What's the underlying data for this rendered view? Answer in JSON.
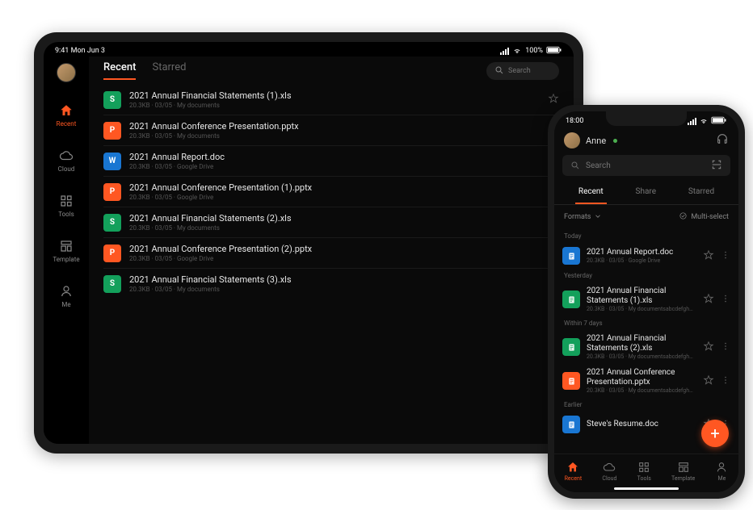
{
  "tablet": {
    "status": {
      "time": "9:41 Mon Jun 3",
      "battery": "100%"
    },
    "nav": [
      {
        "label": "Recent",
        "icon": "home"
      },
      {
        "label": "Cloud",
        "icon": "cloud"
      },
      {
        "label": "Tools",
        "icon": "grid"
      },
      {
        "label": "Template",
        "icon": "template"
      },
      {
        "label": "Me",
        "icon": "person"
      }
    ],
    "tabs": [
      {
        "label": "Recent"
      },
      {
        "label": "Starred"
      }
    ],
    "search_placeholder": "Search",
    "files": [
      {
        "type": "xls",
        "name": "2021 Annual Financial Statements (1).xls",
        "meta": "20.3KB · 03/05 · My documents"
      },
      {
        "type": "pptx",
        "name": "2021 Annual Conference Presentation.pptx",
        "meta": "20.3KB · 03/05 · My documents"
      },
      {
        "type": "doc",
        "name": "2021 Annual Report.doc",
        "meta": "20.3KB · 03/05 · Google Drive"
      },
      {
        "type": "pptx",
        "name": "2021 Annual Conference Presentation (1).pptx",
        "meta": "20.3KB · 03/05 · Google Drive"
      },
      {
        "type": "xls",
        "name": "2021 Annual Financial Statements (2).xls",
        "meta": "20.3KB · 03/05 · My documents"
      },
      {
        "type": "pptx",
        "name": "2021 Annual Conference Presentation (2).pptx",
        "meta": "20.3KB · 03/05 · Google Drive"
      },
      {
        "type": "xls",
        "name": "2021 Annual Financial Statements (3).xls",
        "meta": "20.3KB · 03/05 · My documents"
      }
    ]
  },
  "phone": {
    "status": {
      "time": "18:00"
    },
    "user": "Anne",
    "search_placeholder": "Search",
    "tabs": [
      {
        "label": "Recent"
      },
      {
        "label": "Share"
      },
      {
        "label": "Starred"
      }
    ],
    "toolbar": {
      "left": "Formats",
      "right": "Multi-select"
    },
    "nav": [
      {
        "label": "Recent",
        "icon": "home"
      },
      {
        "label": "Cloud",
        "icon": "cloud"
      },
      {
        "label": "Tools",
        "icon": "grid"
      },
      {
        "label": "Template",
        "icon": "template"
      },
      {
        "label": "Me",
        "icon": "person"
      }
    ],
    "sections": [
      {
        "title": "Today",
        "items": [
          {
            "type": "doc",
            "name": "2021 Annual Report.doc",
            "meta": "20.3KB · 03/05 · Google Drive"
          }
        ]
      },
      {
        "title": "Yesterday",
        "items": [
          {
            "type": "xls",
            "name": "2021 Annual Financial Statements (1).xls",
            "meta": "20.3KB · 03/05 · My documentsabcdefgh…"
          }
        ]
      },
      {
        "title": "Within 7 days",
        "items": [
          {
            "type": "xls",
            "name": "2021 Annual Financial Statements (2).xls",
            "meta": "20.3KB · 03/05 · My documentsabcdefgh…"
          },
          {
            "type": "pptx",
            "name": "2021 Annual Conference Presentation.pptx",
            "meta": "20.3KB · 03/05 · My documentsabcdefgh…"
          }
        ]
      },
      {
        "title": "Earlier",
        "items": [
          {
            "type": "doc",
            "name": "Steve's Resume.doc",
            "meta": ""
          }
        ]
      }
    ]
  },
  "icons": {
    "home": "<svg viewBox='0 0 24 24' width='18' height='18'><path fill='currentColor' d='M12 3l9 8h-3v9h-4v-6h-4v6H6v-9H3z'/></svg>",
    "cloud": "<svg viewBox='0 0 24 24' width='18' height='18'><path fill='none' stroke='currentColor' stroke-width='1.6' d='M7 18a5 5 0 010-10 6 6 0 0111 2 4 4 0 010 8H7z'/></svg>",
    "grid": "<svg viewBox='0 0 24 24' width='18' height='18'><path fill='none' stroke='currentColor' stroke-width='1.6' d='M4 4h6v6H4zM14 4h6v6h-6zM4 14h6v6H4zM14 14h6v6h-6z'/></svg>",
    "template": "<svg viewBox='0 0 24 24' width='18' height='18'><path fill='none' stroke='currentColor' stroke-width='1.6' d='M4 4h16v5H4zM4 12h7v8H4zM14 12h6v8h-6z'/></svg>",
    "person": "<svg viewBox='0 0 24 24' width='18' height='18'><path fill='none' stroke='currentColor' stroke-width='1.6' d='M12 12a4 4 0 100-8 4 4 0 000 8zm-7 8c0-3.3 3.1-6 7-6s7 2.7 7 6'/></svg>",
    "search": "<svg viewBox='0 0 24 24' width='12' height='12'><circle cx='10' cy='10' r='6' fill='none' stroke='currentColor' stroke-width='2'/><line x1='15' y1='15' x2='20' y2='20' stroke='currentColor' stroke-width='2'/></svg>",
    "star": "<svg viewBox='0 0 24 24' width='14' height='14'><path fill='none' stroke='currentColor' stroke-width='1.5' d='M12 3l2.5 6H21l-5 4 2 7-6-4-6 4 2-7-5-4h6.5z'/></svg>",
    "headphone": "<svg viewBox='0 0 24 24' width='16' height='16'><path fill='none' stroke='currentColor' stroke-width='1.6' d='M4 14v-2a8 8 0 0116 0v2M4 14v4a2 2 0 002 2h1v-6H4zm16 0v4a2 2 0 01-2 2h-1v-6h3z'/></svg>",
    "scan": "<svg viewBox='0 0 24 24' width='14' height='14'><path fill='none' stroke='currentColor' stroke-width='1.8' d='M4 8V4h4M20 8V4h-4M4 16v4h4M20 16v4h-4M3 12h18'/></svg>",
    "chevdown": "<svg viewBox='0 0 24 24' width='10' height='10'><path fill='none' stroke='currentColor' stroke-width='2' d='M6 9l6 6 6-6'/></svg>",
    "check": "<svg viewBox='0 0 24 24' width='11' height='11'><circle cx='12' cy='12' r='8' fill='none' stroke='currentColor' stroke-width='1.5'/><path fill='none' stroke='currentColor' stroke-width='1.5' d='M8 12l3 3 5-6'/></svg>",
    "more": "<svg viewBox='0 0 24 24' width='12' height='12'><circle cx='12' cy='5' r='1.5' fill='currentColor'/><circle cx='12' cy='12' r='1.5' fill='currentColor'/><circle cx='12' cy='19' r='1.5' fill='currentColor'/></svg>",
    "wifi": "<svg viewBox='0 0 24 24' width='12' height='12'><path fill='currentColor' d='M12 20a1.5 1.5 0 100-3 1.5 1.5 0 000 3zm-4-4a6 6 0 018 0l-1.5 1.5a4 4 0 00-5 0zm-3-3a10 10 0 0114 0l-1.5 1.5a8 8 0 00-11 0z'/></svg>",
    "battery": "<svg viewBox='0 0 26 12' width='20' height='10'><rect x='1' y='1' width='20' height='10' rx='2' fill='none' stroke='currentColor'/><rect x='22' y='4' width='2' height='4' fill='currentColor'/><rect x='2.5' y='2.5' width='17' height='7' fill='currentColor'/></svg>"
  },
  "file_glyph": {
    "xls": "S",
    "pptx": "P",
    "doc": "W"
  }
}
